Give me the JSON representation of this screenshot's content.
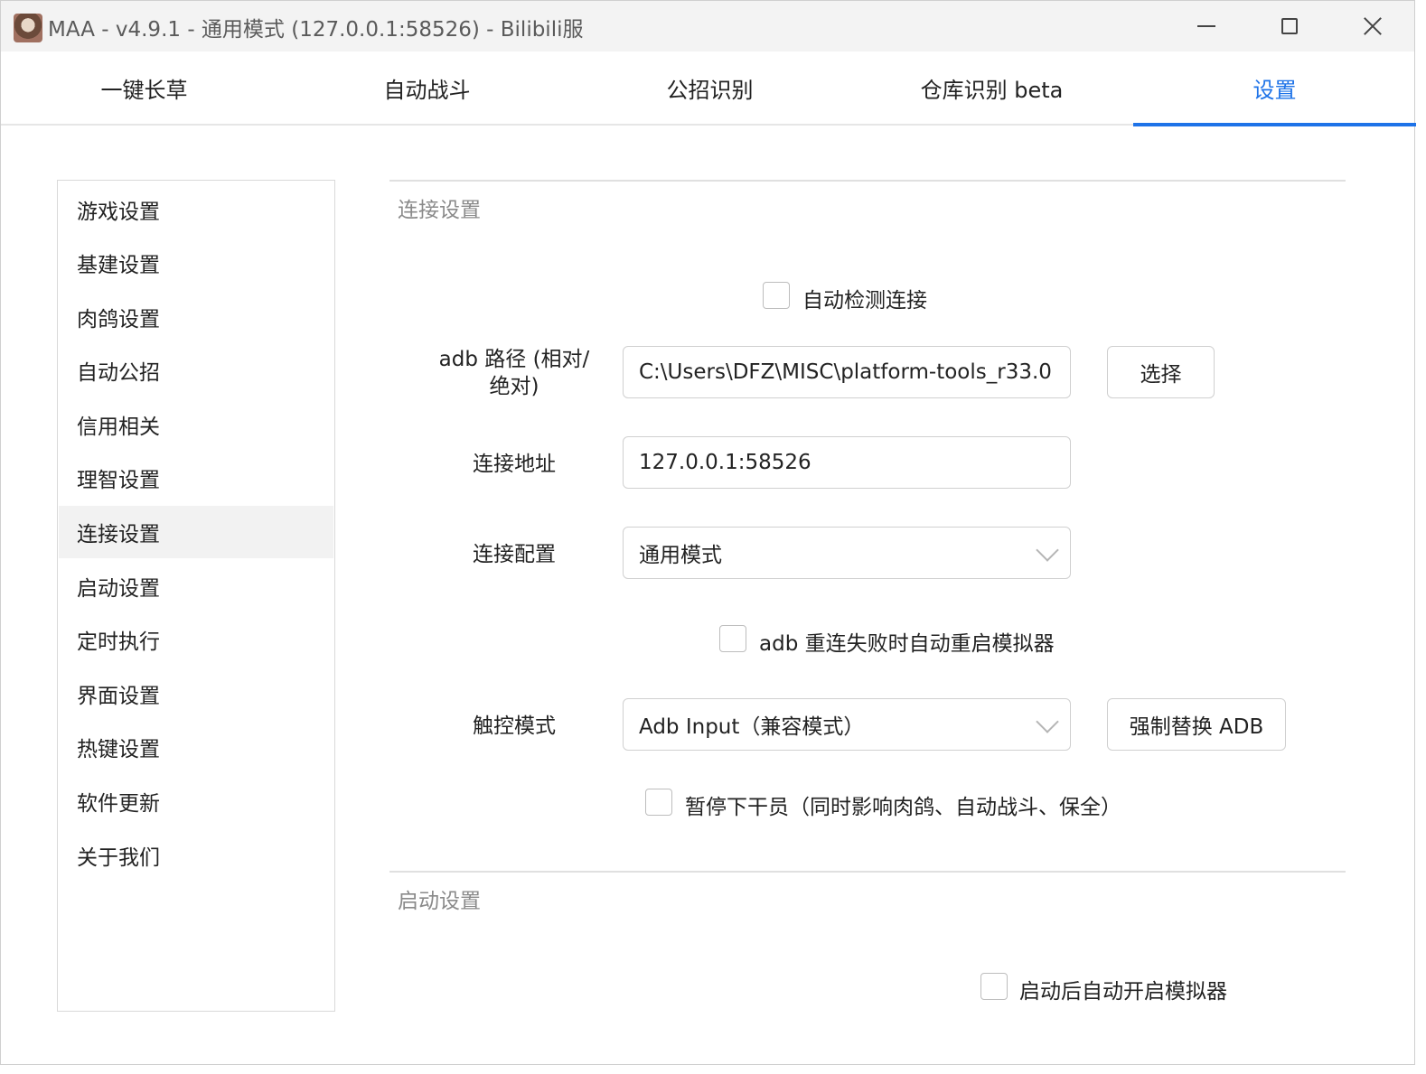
{
  "window": {
    "title": "MAA - v4.9.1 - 通用模式 (127.0.0.1:58526) - Bilibili服"
  },
  "tabs": [
    {
      "label": "一键长草"
    },
    {
      "label": "自动战斗"
    },
    {
      "label": "公招识别"
    },
    {
      "label": "仓库识别 beta"
    },
    {
      "label": "设置"
    }
  ],
  "active_tab": "设置",
  "sidebar": {
    "items": [
      {
        "label": "游戏设置"
      },
      {
        "label": "基建设置"
      },
      {
        "label": "肉鸽设置"
      },
      {
        "label": "自动公招"
      },
      {
        "label": "信用相关"
      },
      {
        "label": "理智设置"
      },
      {
        "label": "连接设置"
      },
      {
        "label": "启动设置"
      },
      {
        "label": "定时执行"
      },
      {
        "label": "界面设置"
      },
      {
        "label": "热键设置"
      },
      {
        "label": "软件更新"
      },
      {
        "label": "关于我们"
      }
    ],
    "selected": "连接设置"
  },
  "connection": {
    "section_title": "连接设置",
    "auto_detect_label": "自动检测连接",
    "auto_detect_checked": false,
    "adb_path_label": "adb 路径 (相对/绝对)",
    "adb_path_value": "C:\\Users\\DFZ\\MISC\\platform-tools_r33.0",
    "select_button": "选择",
    "address_label": "连接地址",
    "address_value": "127.0.0.1:58526",
    "config_label": "连接配置",
    "config_value": "通用模式",
    "retry_restart_label": "adb 重连失败时自动重启模拟器",
    "retry_restart_checked": false,
    "touch_mode_label": "触控模式",
    "touch_mode_value": "Adb Input（兼容模式）",
    "force_replace_button": "强制替换 ADB",
    "pause_label": "暂停下干员（同时影响肉鸽、自动战斗、保全）",
    "pause_checked": false
  },
  "startup": {
    "section_title": "启动设置",
    "auto_start_label": "启动后自动开启模拟器",
    "auto_start_checked": false
  },
  "colors": {
    "accent": "#1e73e8",
    "selected_bg": "#f2f2f2"
  }
}
